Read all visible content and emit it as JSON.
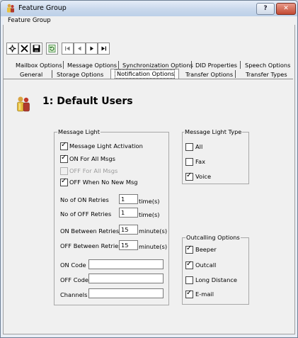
{
  "window": {
    "title": "Feature Group"
  },
  "menubar": {
    "label": "Feature Group"
  },
  "toolbar": {
    "buttons": [
      "add-icon",
      "delete-icon",
      "save-icon",
      "refresh-icon",
      "first-icon",
      "previous-icon",
      "next-icon",
      "last-icon"
    ]
  },
  "tabs": {
    "row1": {
      "mailbox": "Mailbox Options",
      "message": "Message Options",
      "synchronization": "Synchronization Options",
      "did": "DID Properties",
      "speech": "Speech Options"
    },
    "row2": {
      "general": "General",
      "storage": "Storage Options",
      "notification": "Notification Options",
      "transfer": "Transfer Options",
      "transfer_types": "Transfer Types"
    },
    "active": "Notification Options"
  },
  "heading": "1: Default Users",
  "message_light": {
    "title": "Message Light",
    "activation": "Message Light Activation",
    "on_for_all": "ON For All Msgs",
    "off_for_all": "OFF For All Msgs",
    "off_when_no_new": "OFF When No New Msg",
    "no_on_retries_label": "No of ON Retries",
    "no_on_retries_value": "1",
    "no_on_retries_unit": "time(s)",
    "no_off_retries_label": "No of OFF Retries",
    "no_off_retries_value": "1",
    "no_off_retries_unit": "time(s)",
    "on_between_label": "ON Between Retries",
    "on_between_value": "15",
    "on_between_unit": "minute(s)",
    "off_between_label": "OFF Between Retries",
    "off_between_value": "15",
    "off_between_unit": "minute(s)",
    "on_code_label": "ON Code",
    "on_code_value": "",
    "off_code_label": "OFF Code",
    "off_code_value": "",
    "channels_label": "Channels",
    "channels_value": ""
  },
  "message_light_type": {
    "title": "Message Light Type",
    "all": "All",
    "fax": "Fax",
    "voice": "Voice"
  },
  "outcalling": {
    "title": "Outcalling Options",
    "beeper": "Beeper",
    "outcall": "Outcall",
    "long_distance": "Long Distance",
    "email": "E-mail"
  },
  "colors": {
    "titlebar": "#c9d8ec",
    "close_button": "#c24a33",
    "panel": "#f0f0f0"
  }
}
